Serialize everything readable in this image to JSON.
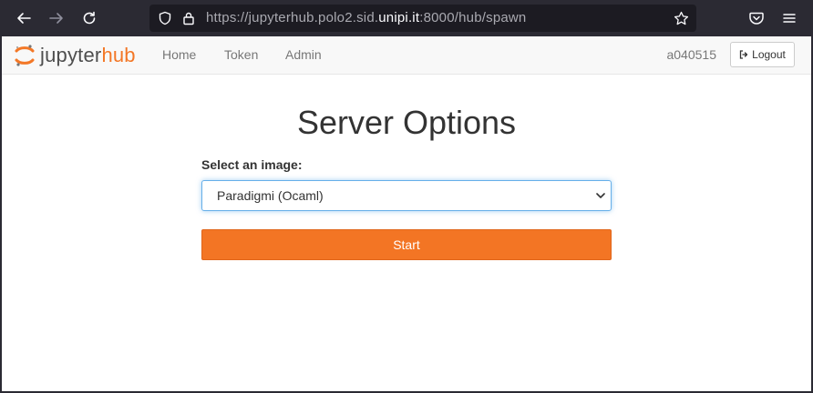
{
  "browser": {
    "url_prefix": "https://jupyterhub.polo2.sid.",
    "url_host": "unipi.it",
    "url_suffix": ":8000/hub/spawn"
  },
  "navbar": {
    "logo_jupyter": "jupyter",
    "logo_hub": "hub",
    "links": [
      "Home",
      "Token",
      "Admin"
    ],
    "username": "a040515",
    "logout_label": "Logout"
  },
  "main": {
    "title": "Server Options",
    "image_label": "Select an image:",
    "image_selected": "Paradigmi (Ocaml)",
    "start_label": "Start"
  },
  "colors": {
    "brand_orange": "#f37726",
    "start_button": "#f37524",
    "focus_border": "#66afe9"
  }
}
